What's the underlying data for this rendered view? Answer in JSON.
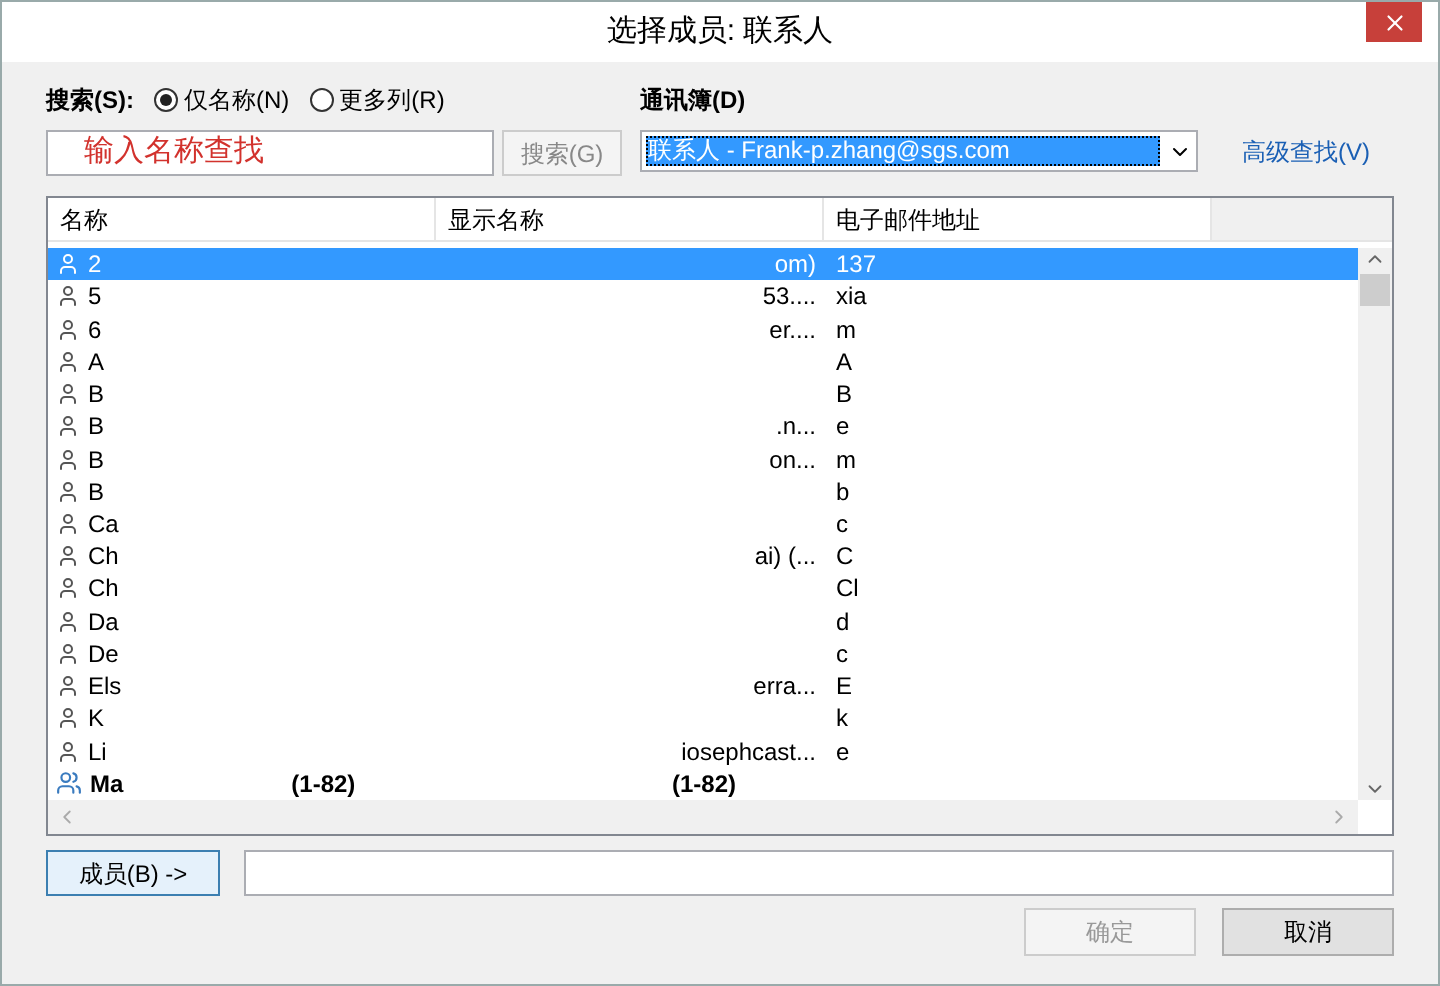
{
  "window": {
    "title": "选择成员: 联系人"
  },
  "search": {
    "label": "搜索(S):",
    "options": [
      {
        "label": "仅名称(N)",
        "selected": true
      },
      {
        "label": "更多列(R)",
        "selected": false
      }
    ],
    "value": "输入名称查找",
    "button": "搜索(G)"
  },
  "address_book": {
    "label": "通讯簿(D)",
    "value": "联系人 - Frank-p.zhang@sgs.com",
    "advanced_link": "高级查找(V)"
  },
  "table": {
    "columns": [
      "名称",
      "显示名称",
      "电子邮件地址"
    ],
    "rows": [
      {
        "kind": "contact",
        "selected": true,
        "name": "2",
        "display": "om)",
        "email": "137"
      },
      {
        "kind": "contact",
        "selected": false,
        "name": "5",
        "display": "53....",
        "email": "xia"
      },
      {
        "kind": "contact",
        "selected": false,
        "name": "6",
        "display": "er....",
        "email": "m"
      },
      {
        "kind": "contact",
        "selected": false,
        "name": "A",
        "email": "A"
      },
      {
        "kind": "contact",
        "selected": false,
        "name": "B",
        "email": "B"
      },
      {
        "kind": "contact",
        "selected": false,
        "name": "B",
        "display": ".n...",
        "email": "e"
      },
      {
        "kind": "contact",
        "selected": false,
        "name": "B",
        "display": "on...",
        "email": "m"
      },
      {
        "kind": "contact",
        "selected": false,
        "name": "B",
        "email": "b"
      },
      {
        "kind": "contact",
        "selected": false,
        "name": "Ca",
        "email": "c"
      },
      {
        "kind": "contact",
        "selected": false,
        "name": "Ch",
        "display": "ai) (...",
        "email": "C"
      },
      {
        "kind": "contact",
        "selected": false,
        "name": "Ch",
        "email": "Cl"
      },
      {
        "kind": "contact",
        "selected": false,
        "name": "Da",
        "email": "d"
      },
      {
        "kind": "contact",
        "selected": false,
        "name": "De",
        "email": "c"
      },
      {
        "kind": "contact",
        "selected": false,
        "name": "Els",
        "display": "erra...",
        "email": "E"
      },
      {
        "kind": "contact",
        "selected": false,
        "name": "K",
        "email": "k"
      },
      {
        "kind": "contact",
        "selected": false,
        "name": "Li",
        "display": "iosephcast...",
        "email": "e"
      },
      {
        "kind": "group",
        "selected": false,
        "name": "Ma",
        "name_tail": "(1-82)",
        "display": "(1-82)"
      }
    ]
  },
  "members": {
    "button": "成员(B) ->"
  },
  "buttons": [
    {
      "label": "确定",
      "disabled": true
    },
    {
      "label": "取消",
      "disabled": false
    }
  ]
}
